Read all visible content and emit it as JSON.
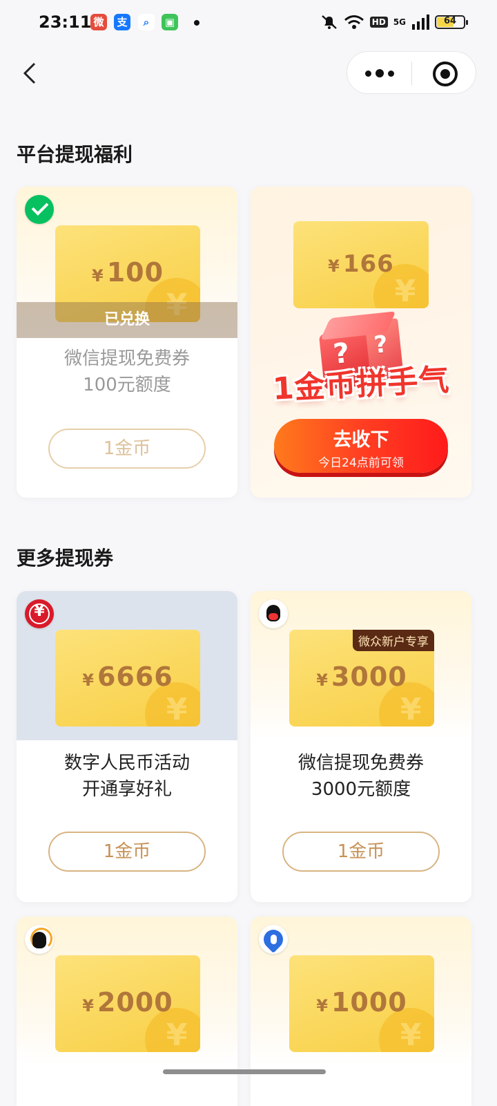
{
  "status_bar": {
    "time": "23:11",
    "apps": [
      "weibo-icon",
      "alipay-icon",
      "search-app-icon",
      "android-app-icon"
    ],
    "hd": "HD",
    "network": "5G",
    "battery": "64",
    "battery_level": 0.64
  },
  "nav": {
    "back_icon": "chevron-left-icon",
    "more_icon": "more-icon",
    "close_icon": "target-icon"
  },
  "section1": {
    "title": "平台提现福利"
  },
  "card_wechat100": {
    "icon": "wechat-icon",
    "currency": "¥",
    "amount": "100",
    "status": "已兑换",
    "line1": "微信提现免费券",
    "line2": "100元额度",
    "button": "1金币"
  },
  "promo": {
    "currency": "¥",
    "amount": "166",
    "box_marks": "?",
    "slogan": "1金币拼手气",
    "button_main": "去收下",
    "button_sub": "今日24点前可领",
    "accent": "#ff3f22"
  },
  "section2": {
    "title": "更多提现券"
  },
  "card_rmb": {
    "icon": "digital-rmb-icon",
    "currency": "¥",
    "amount": "6666",
    "line1": "数字人民币活动",
    "line2": "开通享好礼",
    "button": "1金币"
  },
  "card_3000": {
    "icon": "penguin-icon",
    "badge": "微众新户专享",
    "currency": "¥",
    "amount": "3000",
    "line1": "微信提现免费券",
    "line2": "3000元额度",
    "button": "1金币"
  },
  "card_2000": {
    "icon": "penguin-gold-icon",
    "currency": "¥",
    "amount": "2000"
  },
  "card_1000": {
    "icon": "blue-drop-icon",
    "currency": "¥",
    "amount": "1000"
  }
}
